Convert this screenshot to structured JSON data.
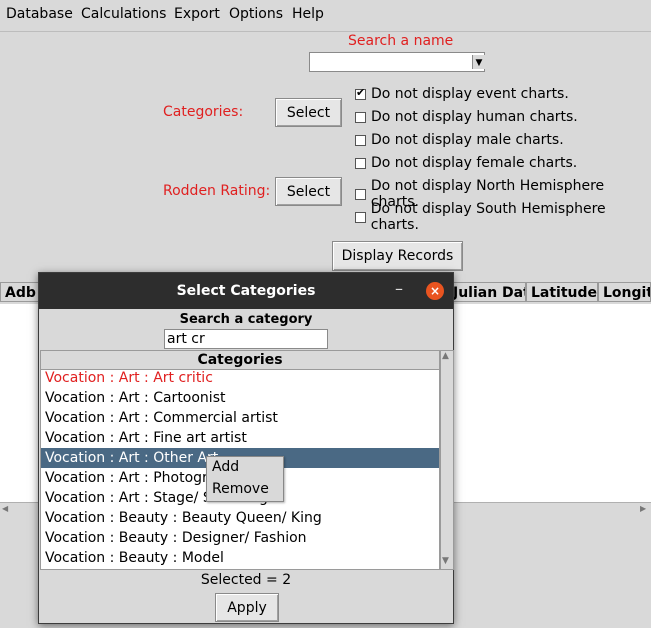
{
  "menu": [
    "Database",
    "Calculations",
    "Export",
    "Options",
    "Help"
  ],
  "search_name": {
    "label": "Search a name",
    "value": ""
  },
  "categories_label": "Categories:",
  "rodden_label": "Rodden Rating:",
  "select_label": "Select",
  "checkboxes": [
    {
      "label": "Do not display event charts.",
      "checked": true
    },
    {
      "label": "Do not display human charts.",
      "checked": false
    },
    {
      "label": "Do not display male charts.",
      "checked": false
    },
    {
      "label": "Do not display female charts.",
      "checked": false
    },
    {
      "label": "Do not display North Hemisphere charts.",
      "checked": false
    },
    {
      "label": "Do not display South Hemisphere charts.",
      "checked": false
    }
  ],
  "display_records_label": "Display Records",
  "table_columns": [
    "Adb",
    "Julian Dat",
    "Latitude",
    "Longitu"
  ],
  "dialog": {
    "title": "Select Categories",
    "min_symbol": "–",
    "close_symbol": "×",
    "search_label": "Search a category",
    "search_value": "art cr",
    "list_header": "Categories",
    "items": [
      "Vocation : Art : Art critic",
      "Vocation : Art : Cartoonist",
      "Vocation : Art : Commercial artist",
      "Vocation : Art : Fine art artist",
      "Vocation : Art : Other Art",
      "Vocation : Art : Photographer",
      "Vocation : Art : Stage/ Set design",
      "Vocation : Beauty : Beauty Queen/ King",
      "Vocation : Beauty : Designer/ Fashion",
      "Vocation : Beauty : Model"
    ],
    "highlighted_item_index": 4,
    "red_item_index": 0,
    "selected_count": "Selected = 2",
    "apply_label": "Apply"
  },
  "context_menu": [
    "Add",
    "Remove"
  ],
  "colors": {
    "accent_red": "#e02020",
    "selection": "#4a6984",
    "title_bar": "#2d2d2d",
    "close_button": "#e95420"
  }
}
